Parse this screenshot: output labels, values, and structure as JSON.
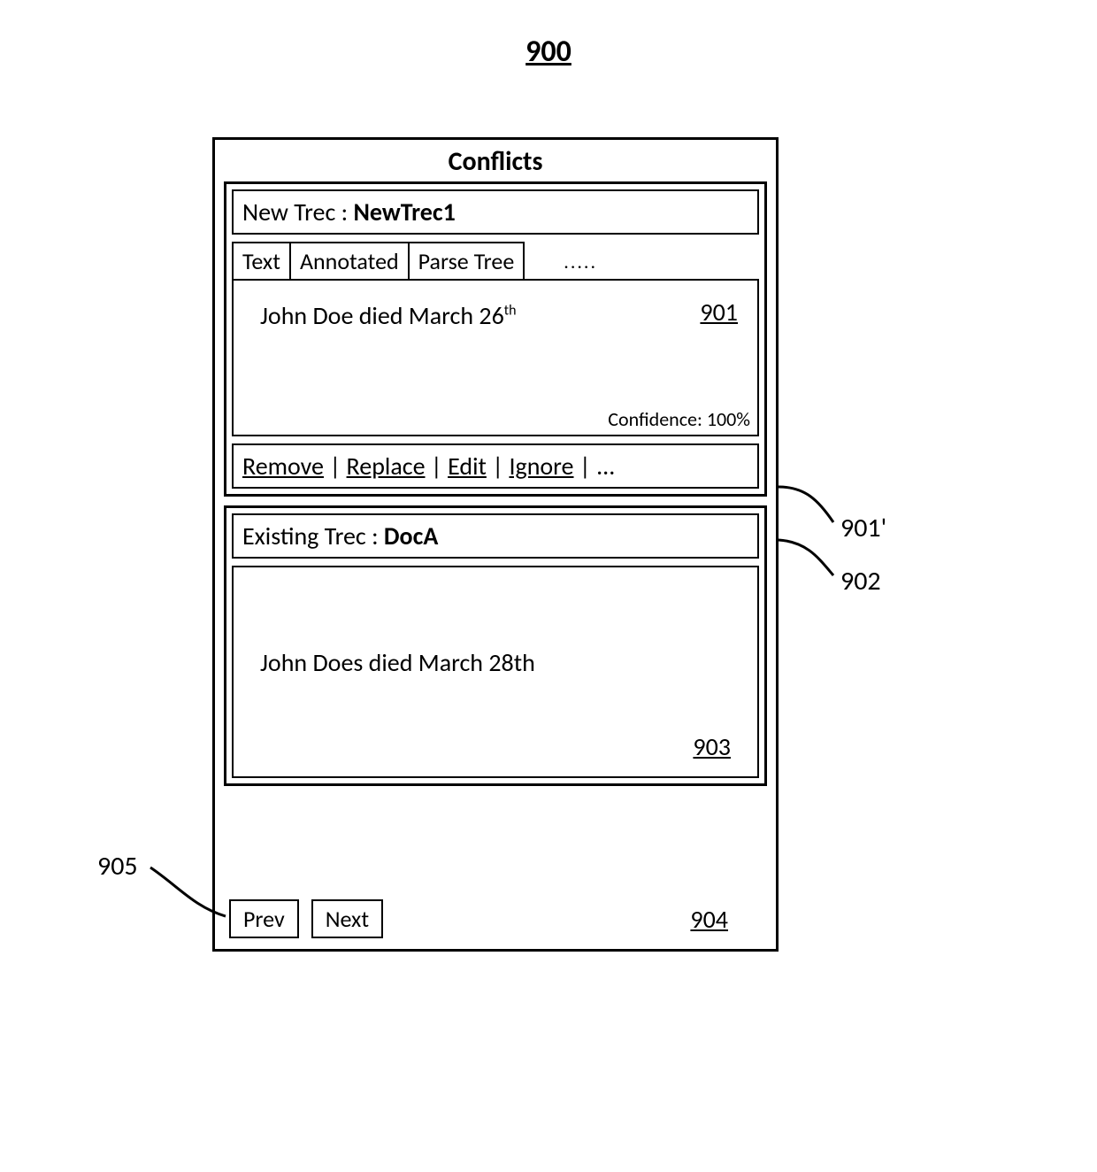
{
  "figure_number": "900",
  "panel": {
    "title": "Conflicts"
  },
  "new_trec": {
    "label_prefix": "New Trec : ",
    "name": "NewTrec1",
    "tabs": [
      "Text",
      "Annotated",
      "Parse Tree"
    ],
    "tabs_more": ".....",
    "content_prefix": "John Doe died March 26",
    "content_ord": "th",
    "ref": "901",
    "confidence_label": "Confidence: 100%",
    "actions": [
      "Remove",
      "Replace",
      "Edit",
      "Ignore"
    ],
    "actions_more": "..."
  },
  "existing_trec": {
    "label_prefix": "Existing Trec : ",
    "name": "DocA",
    "content": "John Does died March 28th",
    "ref": "903"
  },
  "footer": {
    "prev": "Prev",
    "next": "Next",
    "ref": "904"
  },
  "callouts": {
    "c901p": "901'",
    "c902": "902",
    "c905": "905"
  }
}
